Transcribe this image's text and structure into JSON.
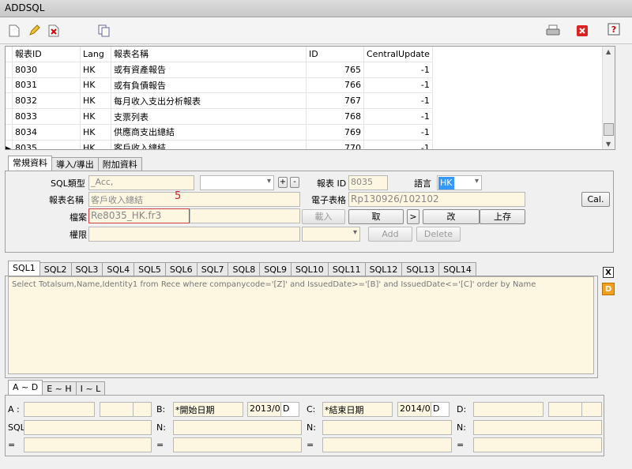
{
  "window": {
    "title": "ADDSQL"
  },
  "grid": {
    "columns": [
      "報表ID",
      "Lang",
      "報表名稱",
      "ID",
      "CentralUpdate"
    ],
    "rows": [
      [
        "8030",
        "HK",
        "或有資產報告",
        "765",
        "-1"
      ],
      [
        "8031",
        "HK",
        "或有負債報告",
        "766",
        "-1"
      ],
      [
        "8032",
        "HK",
        "每月收入支出分析報表",
        "767",
        "-1"
      ],
      [
        "8033",
        "HK",
        "支票列表",
        "768",
        "-1"
      ],
      [
        "8034",
        "HK",
        "供應商支出總結",
        "769",
        "-1"
      ],
      [
        "8035",
        "HK",
        "客戶收入總結",
        "770",
        "-1"
      ]
    ]
  },
  "main_tabs": [
    "常規資料",
    "導入/導出",
    "附加資料"
  ],
  "form": {
    "sql_type_label": "SQL類型",
    "sql_type_value": "_Acc,",
    "report_name_label": "報表名稱",
    "report_name_value": "客戶收入總結",
    "annotation": "5",
    "file_label": "檔案",
    "file_value": "Re8035_HK.fr3",
    "permission_label": "權限",
    "report_id_label": "報表 ID",
    "report_id_value": "8035",
    "lang_label": "語言",
    "lang_value": "HK",
    "sheet_label": "電子表格",
    "sheet_value": "Rp130926/102102",
    "cal_button": "Cal.",
    "plus_button": "+",
    "minus_button": "-",
    "load_button": "載入",
    "take_button": "取",
    "arrow_button": ">",
    "edit_button": "改",
    "upload_button": "上存",
    "add_button": "Add",
    "delete_button": "Delete"
  },
  "sql_tabs": [
    "SQL1",
    "SQL2",
    "SQL3",
    "SQL4",
    "SQL5",
    "SQL6",
    "SQL7",
    "SQL8",
    "SQL9",
    "SQL10",
    "SQL11",
    "SQL12",
    "SQL13",
    "SQL14"
  ],
  "sql_text": "Select Totalsum,Name,Identity1 from Rece where companycode='[Z]' and IssuedDate>='[B]' and IssuedDate<='[C]' order by Name",
  "side_buttons": {
    "x": "X",
    "d": "D"
  },
  "param_tabs": [
    "A ~ D",
    "E ~ H",
    "I ~ L"
  ],
  "params": {
    "a_label": "A :",
    "b_label": "B:",
    "b_value": "*開始日期",
    "b_date": "2013/0",
    "b_type": "D",
    "c_label": "C:",
    "c_value": "*結束日期",
    "c_date": "2014/0",
    "c_type": "D",
    "d_label": "D:",
    "sql_label": "SQL",
    "n_label": "N:",
    "eq_label": "="
  }
}
